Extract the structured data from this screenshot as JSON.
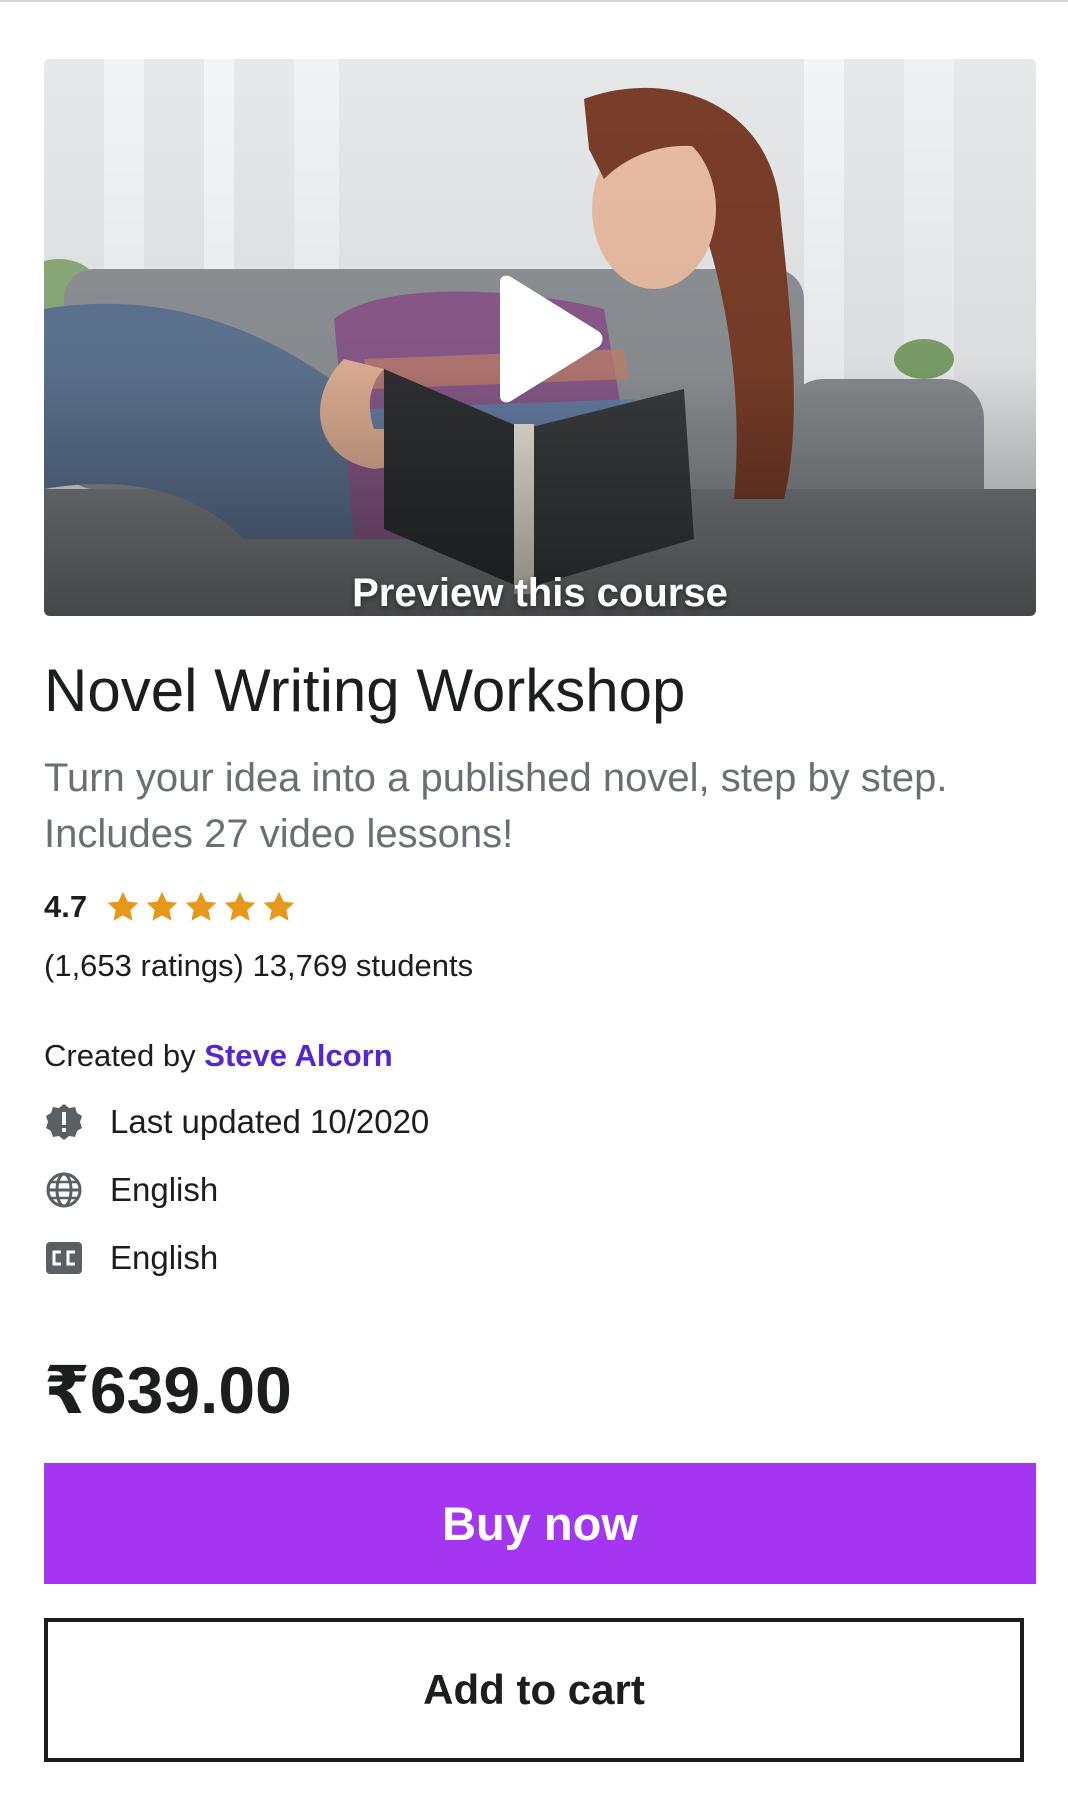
{
  "preview": {
    "label": "Preview this course",
    "play_icon": "play-icon"
  },
  "course": {
    "title": "Novel Writing Workshop",
    "subtitle": "Turn your idea into a published novel, step by step. Includes 27 video lessons!",
    "rating": "4.7",
    "rating_stars": 4.7,
    "stats": "(1,653 ratings) 13,769 students"
  },
  "creator": {
    "prefix": "Created by",
    "name": "Steve Alcorn"
  },
  "meta": {
    "last_updated": "Last updated 10/2020",
    "language": "English",
    "captions": "English",
    "icons": [
      "alert-badge-icon",
      "globe-icon",
      "closed-captions-icon"
    ]
  },
  "pricing": {
    "price": "₹639.00",
    "buy_label": "Buy now",
    "cart_label": "Add to cart"
  },
  "colors": {
    "accent": "#a435f0",
    "link": "#5624d0",
    "star": "#e59819",
    "text": "#1c1d1f",
    "muted": "#6a6f73"
  }
}
